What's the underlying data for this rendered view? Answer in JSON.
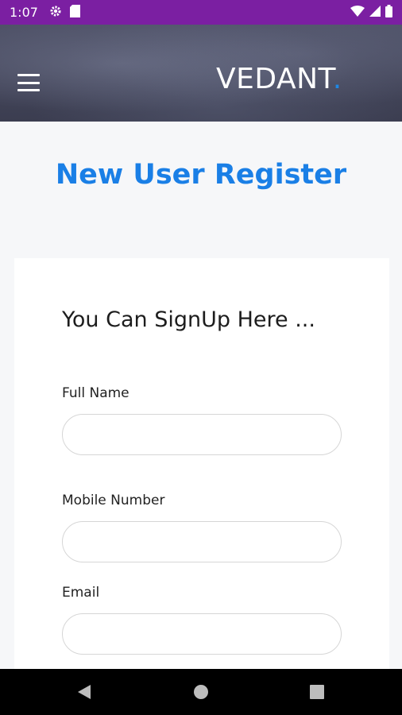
{
  "status_bar": {
    "time": "1:07",
    "icons": [
      "gear-icon",
      "sd-card-icon"
    ],
    "right_icons": [
      "wifi-icon",
      "signal-icon",
      "battery-icon"
    ],
    "color": "#7b1fa2"
  },
  "header": {
    "brand": "VEDANT",
    "brand_dot": ".",
    "menu_icon": "hamburger-menu-icon",
    "accent": "#1e88e5"
  },
  "page": {
    "title": "New User Register",
    "title_color": "#1a7fe6"
  },
  "form": {
    "heading": "You Can SignUp Here ...",
    "fields": [
      {
        "label": "Full Name",
        "value": "",
        "placeholder": ""
      },
      {
        "label": "Mobile Number",
        "value": "",
        "placeholder": ""
      },
      {
        "label": "Email",
        "value": "",
        "placeholder": ""
      }
    ]
  },
  "nav_bar": {
    "buttons": [
      "back-icon",
      "home-icon",
      "recents-icon"
    ]
  }
}
